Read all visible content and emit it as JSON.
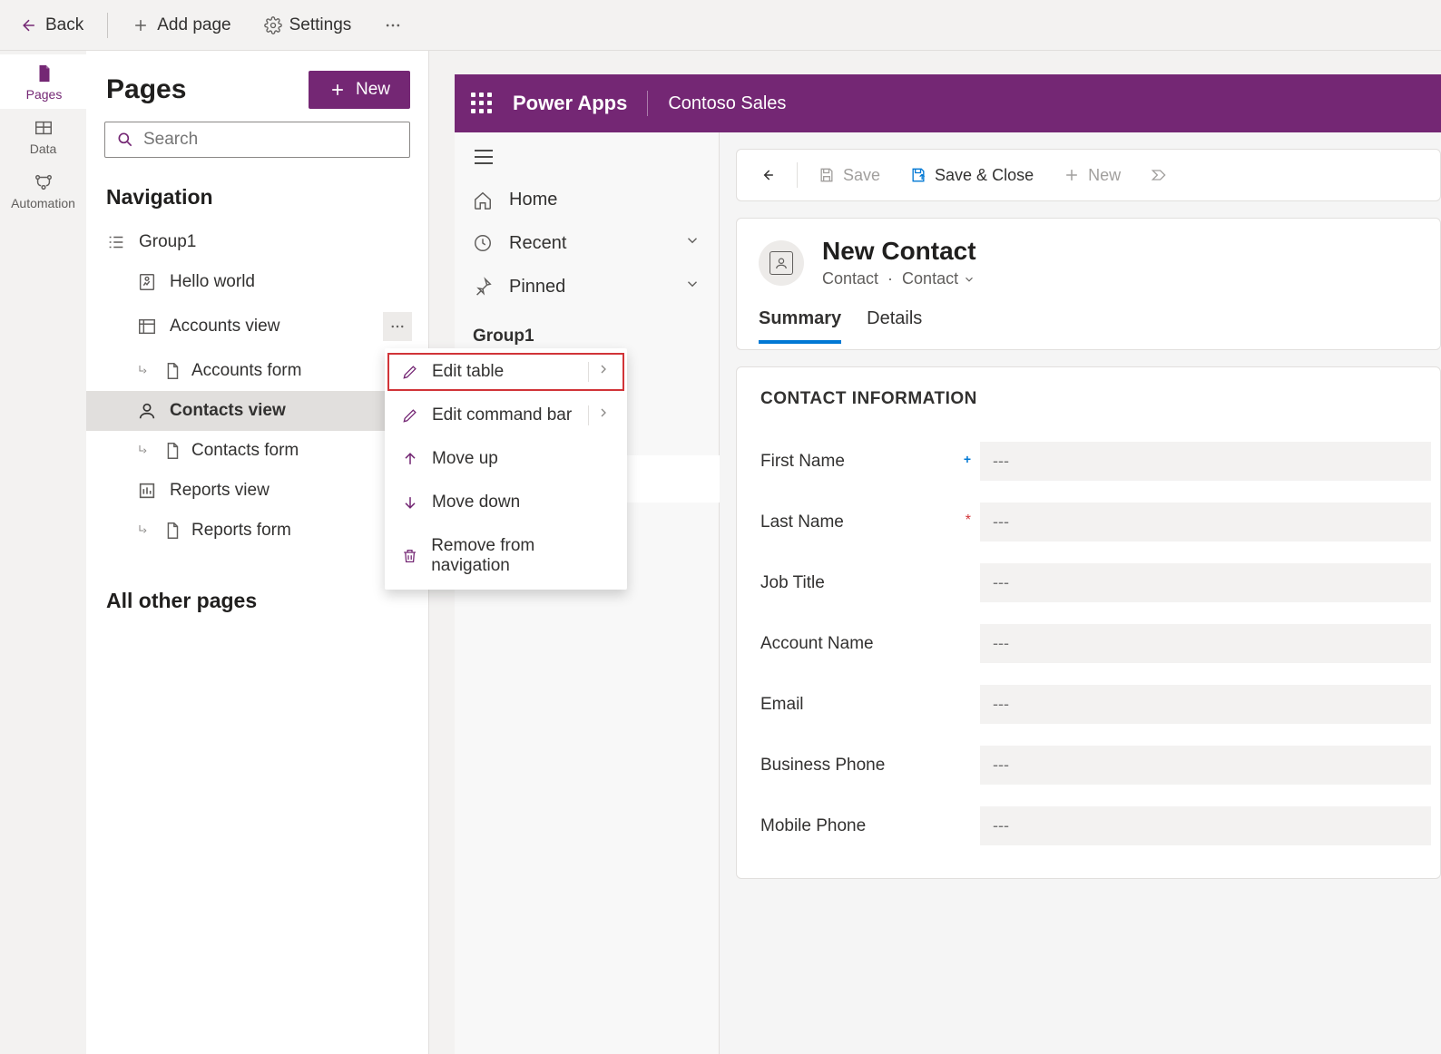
{
  "toolbar": {
    "back": "Back",
    "add_page": "Add page",
    "settings": "Settings"
  },
  "left_rail": {
    "pages": "Pages",
    "data": "Data",
    "automation": "Automation"
  },
  "pages_panel": {
    "title": "Pages",
    "new_button": "New",
    "search_placeholder": "Search",
    "nav_title": "Navigation",
    "group": "Group1",
    "items": [
      {
        "label": "Hello world",
        "type": "dashboard"
      },
      {
        "label": "Accounts view",
        "type": "view"
      },
      {
        "label": "Accounts form",
        "type": "form"
      },
      {
        "label": "Contacts view",
        "type": "view"
      },
      {
        "label": "Contacts form",
        "type": "form"
      },
      {
        "label": "Reports view",
        "type": "chart"
      },
      {
        "label": "Reports form",
        "type": "form"
      }
    ],
    "all_other": "All other pages"
  },
  "context_menu": {
    "edit_table": "Edit table",
    "edit_command_bar": "Edit command bar",
    "move_up": "Move up",
    "move_down": "Move down",
    "remove": "Remove from navigation"
  },
  "app_header": {
    "brand": "Power Apps",
    "app_name": "Contoso Sales"
  },
  "app_nav": {
    "home": "Home",
    "recent": "Recent",
    "pinned": "Pinned",
    "group": "Group1"
  },
  "command_bar": {
    "save": "Save",
    "save_close": "Save & Close",
    "new": "New"
  },
  "form": {
    "title": "New Contact",
    "entity": "Contact",
    "form_name": "Contact",
    "tabs": {
      "summary": "Summary",
      "details": "Details"
    },
    "section": "CONTACT INFORMATION",
    "placeholder": "---",
    "fields": {
      "first_name": "First Name",
      "last_name": "Last Name",
      "job_title": "Job Title",
      "account_name": "Account Name",
      "email": "Email",
      "business_phone": "Business Phone",
      "mobile_phone": "Mobile Phone"
    }
  }
}
